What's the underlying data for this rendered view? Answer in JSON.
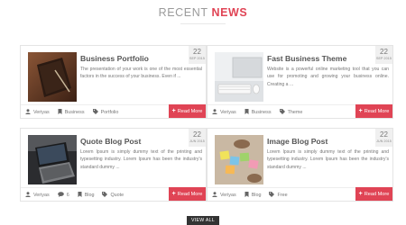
{
  "section": {
    "title_light": "RECENT",
    "title_accent": "NEWS"
  },
  "colors": {
    "accent": "#e04455",
    "dark": "#333333"
  },
  "posts": [
    {
      "title": "Business Portfolio",
      "day": "22",
      "month": "SEP 2015",
      "excerpt": "The presentation of your work is one of the most essential factors in the success of your business. Even if ...",
      "author": "Veriyas",
      "category": "Business",
      "tag": "Portfolio",
      "read_more": "Read More",
      "thumb_icon": "notebook-photo"
    },
    {
      "title": "Fast Business Theme",
      "day": "22",
      "month": "SEP 2015",
      "excerpt": "Website is a powerful online marketing tool that you can use for promoting and growing your business online. Creating a ...",
      "author": "Veriyas",
      "category": "Business",
      "tag": "Theme",
      "read_more": "Read More",
      "thumb_icon": "desk-keyboard-photo"
    },
    {
      "title": "Quote Blog Post",
      "day": "22",
      "month": "JUN 2015",
      "excerpt": "Lorem Ipsum is simply dummy text of the printing and typesetting industry. Lorem Ipsum has been the industry's standard dummy ...",
      "author": "Veriyas",
      "comments": "6",
      "category": "Blog",
      "tag": "Quote",
      "read_more": "Read More",
      "thumb_icon": "laptop-photo"
    },
    {
      "title": "Image Blog Post",
      "day": "22",
      "month": "JUN 2015",
      "excerpt": "Lorem Ipsum is simply dummy text of the printing and typesetting industry. Lorem Ipsum has been the industry's standard dummy ...",
      "author": "Veriyas",
      "category": "Blog",
      "tag": "Free",
      "read_more": "Read More",
      "thumb_icon": "sticky-notes-photo"
    }
  ],
  "view_all": "VIEW ALL"
}
